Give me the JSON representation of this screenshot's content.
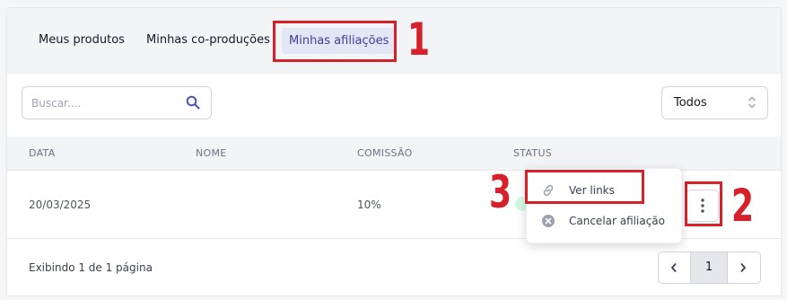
{
  "tabs": [
    {
      "label": "Meus produtos"
    },
    {
      "label": "Minhas co-produções"
    },
    {
      "label": "Minhas afiliações",
      "active": true
    }
  ],
  "search": {
    "placeholder": "Buscar...."
  },
  "filter": {
    "selected": "Todos"
  },
  "table": {
    "headers": [
      "DATA",
      "NOME",
      "COMISSÃO",
      "STATUS"
    ],
    "rows": [
      {
        "data": "20/03/2025",
        "nome": "",
        "comissao": "10%",
        "status": ""
      }
    ]
  },
  "row_menu": {
    "items": [
      {
        "label": "Ver links",
        "icon": "link-icon"
      },
      {
        "label": "Cancelar afiliação",
        "icon": "cancel-circle-icon"
      }
    ]
  },
  "footer": {
    "summary": "Exibindo 1 de 1 página"
  },
  "pagination": {
    "current": "1"
  },
  "annotations": {
    "labels": [
      "1",
      "2",
      "3"
    ],
    "color": "#d6202a"
  },
  "colors": {
    "accent": "#3c3f9c",
    "active_tab_bg": "#e3e6f5",
    "annotation": "#d6202a"
  }
}
